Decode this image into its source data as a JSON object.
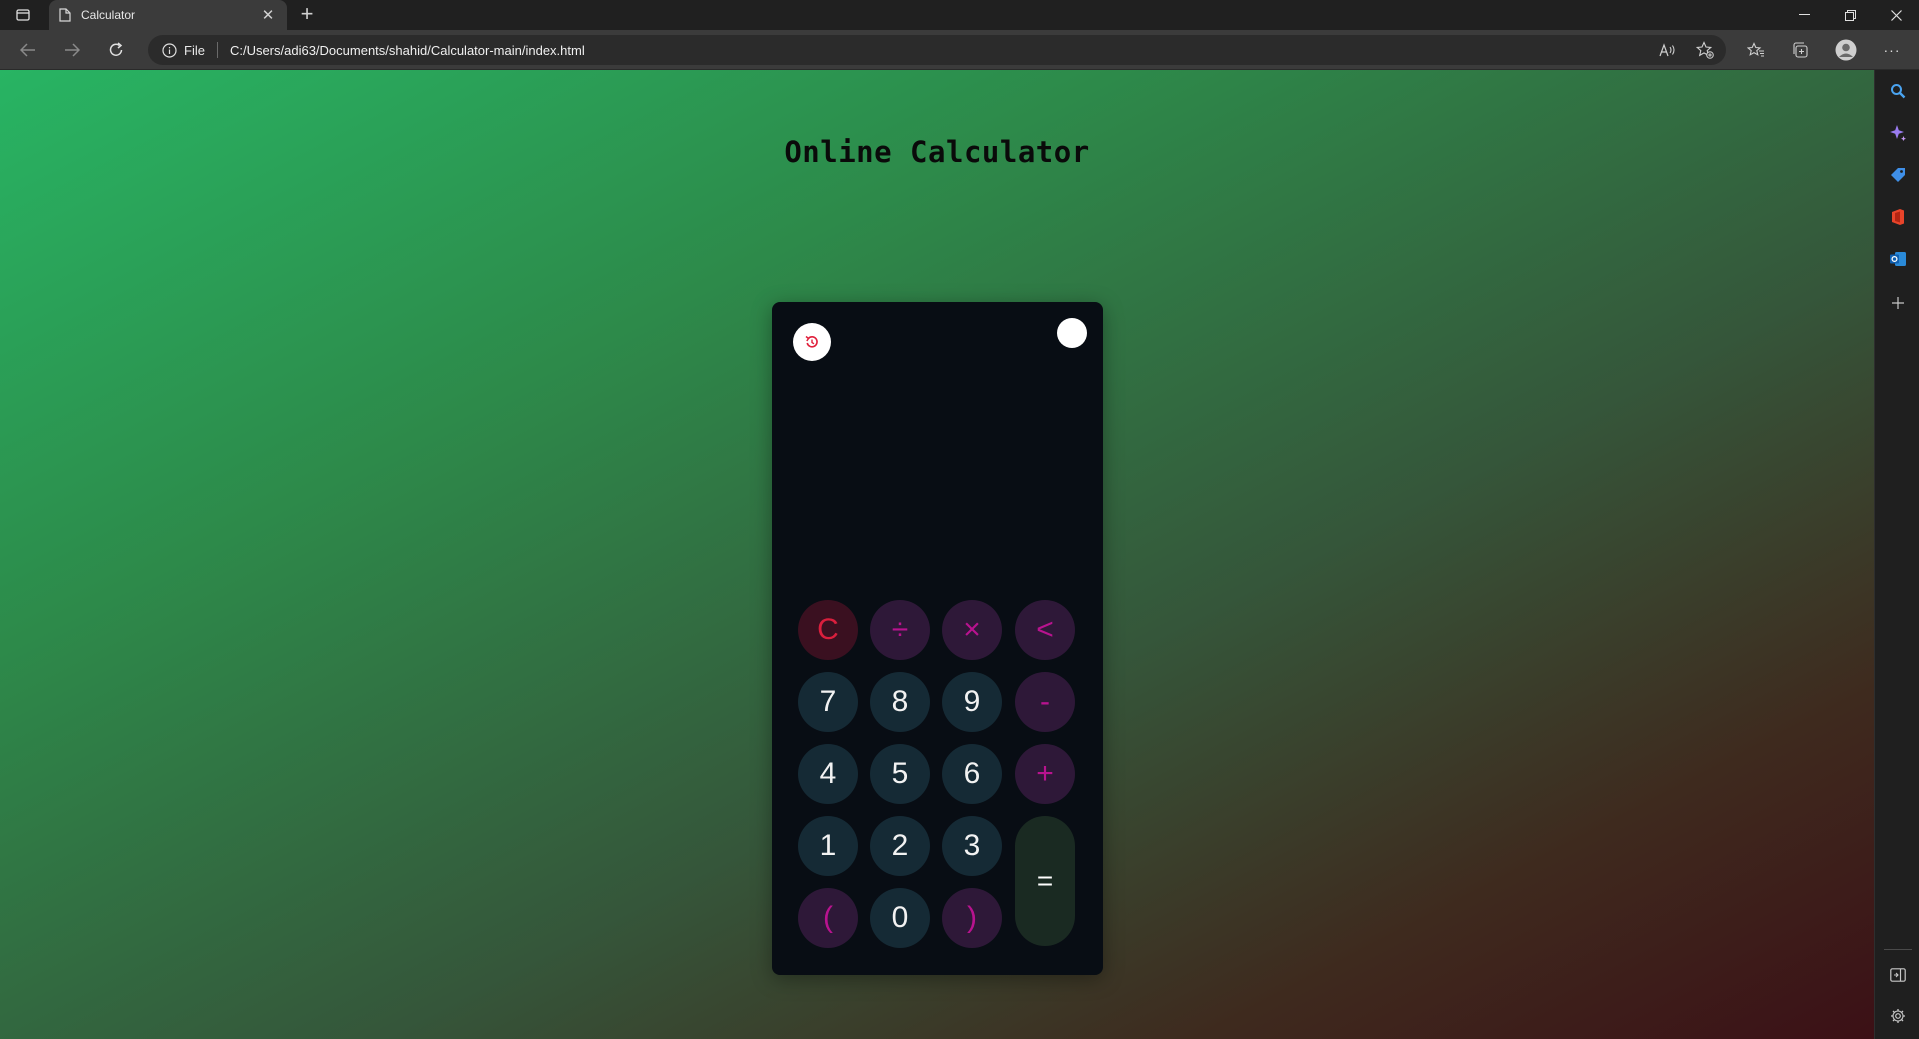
{
  "browser": {
    "tab": {
      "title": "Calculator",
      "close": "✕"
    },
    "new_tab": "+",
    "address": {
      "scheme_label": "File",
      "url": "C:/Users/adi63/Documents/shahid/Calculator-main/index.html"
    },
    "window_controls": {
      "minimize": "–",
      "restore": "❐",
      "close": "✕"
    },
    "more": "···"
  },
  "page": {
    "title": "Online Calculator"
  },
  "calculator": {
    "display": "",
    "keys": {
      "clear": "C",
      "divide": "÷",
      "multiply": "×",
      "backspace": "<",
      "seven": "7",
      "eight": "8",
      "nine": "9",
      "minus": "-",
      "four": "4",
      "five": "5",
      "six": "6",
      "plus": "+",
      "one": "1",
      "two": "2",
      "three": "3",
      "equals": "=",
      "open_paren": "(",
      "zero": "0",
      "close_paren": ")"
    }
  },
  "colors": {
    "calculator_bg": "#080d14",
    "number_key": "#152a35",
    "operator_key": "#2e1838",
    "operator_text": "#b8138f",
    "clear_text": "#d91f3d",
    "history_icon": "#e0203c"
  },
  "icons": {
    "history": "history-icon",
    "search": "search-icon",
    "copilot": "copilot-icon",
    "shopping": "tag-icon",
    "office": "office-icon",
    "outlook": "outlook-icon",
    "add": "plus-icon",
    "settings": "gear-icon"
  }
}
